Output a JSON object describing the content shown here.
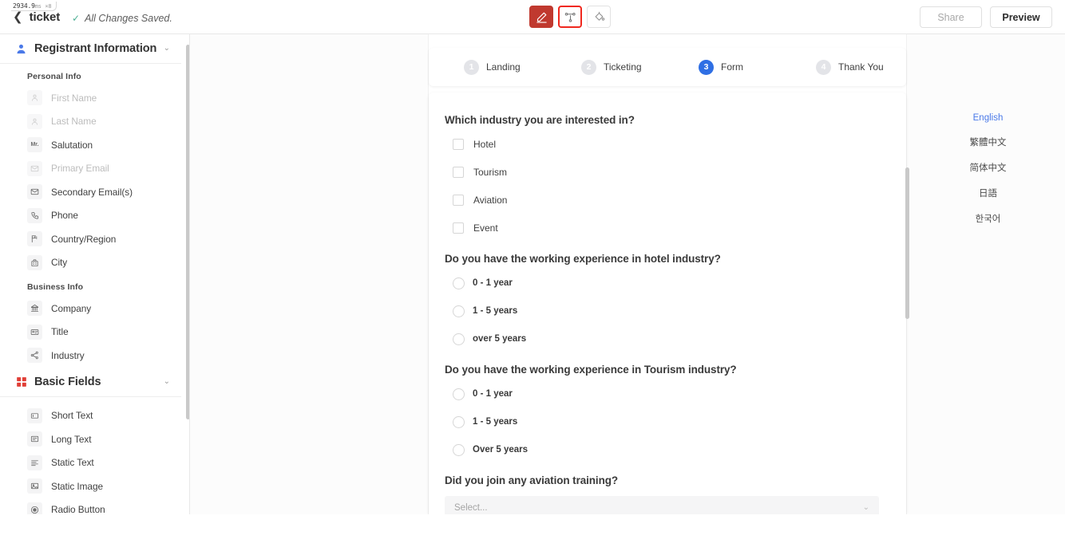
{
  "topbar": {
    "perf_value": "2934.9",
    "perf_unit": "ms",
    "perf_count": "×8",
    "back_icon": "chevron-left-icon",
    "project_name": "ticket",
    "check_icon": "check-icon",
    "save_status": "All Changes Saved.",
    "tools": [
      {
        "name": "edit-pencil-icon",
        "state": "filled"
      },
      {
        "name": "workflow-node-icon",
        "state": "selected"
      },
      {
        "name": "paint-bucket-icon",
        "state": "plain"
      }
    ],
    "share_label": "Share",
    "preview_label": "Preview"
  },
  "sidebar": {
    "panels": [
      {
        "title": "Registrant Information",
        "icon": "user-icon",
        "chevron": "chevron-down-icon",
        "groups": [
          {
            "label": "Personal Info",
            "items": [
              {
                "label": "First Name",
                "icon": "person-outline-icon",
                "disabled": true
              },
              {
                "label": "Last Name",
                "icon": "person-outline-icon",
                "disabled": true
              },
              {
                "label": "Salutation",
                "icon": "mr-icon",
                "disabled": false
              },
              {
                "label": "Primary Email",
                "icon": "envelope-icon",
                "disabled": true
              },
              {
                "label": "Secondary Email(s)",
                "icon": "envelope-icon",
                "disabled": false
              },
              {
                "label": "Phone",
                "icon": "phone-icon",
                "disabled": false
              },
              {
                "label": "Country/Region",
                "icon": "flag-icon",
                "disabled": false
              },
              {
                "label": "City",
                "icon": "building-icon",
                "disabled": false
              }
            ]
          },
          {
            "label": "Business Info",
            "items": [
              {
                "label": "Company",
                "icon": "bank-icon",
                "disabled": false
              },
              {
                "label": "Title",
                "icon": "id-card-icon",
                "disabled": false
              },
              {
                "label": "Industry",
                "icon": "share-nodes-icon",
                "disabled": false
              }
            ]
          }
        ]
      },
      {
        "title": "Basic Fields",
        "icon": "grid-squares-icon",
        "chevron": "chevron-down-icon",
        "groups": [
          {
            "label": "",
            "items": [
              {
                "label": "Short Text",
                "icon": "short-text-icon",
                "disabled": false
              },
              {
                "label": "Long Text",
                "icon": "long-text-icon",
                "disabled": false
              },
              {
                "label": "Static Text",
                "icon": "static-text-icon",
                "disabled": false
              },
              {
                "label": "Static Image",
                "icon": "image-icon",
                "disabled": false
              },
              {
                "label": "Radio Button",
                "icon": "radio-button-icon",
                "disabled": false
              }
            ]
          }
        ]
      }
    ]
  },
  "canvas": {
    "steps": [
      {
        "number": "1",
        "label": "Landing",
        "active": false
      },
      {
        "number": "2",
        "label": "Ticketing",
        "active": false
      },
      {
        "number": "3",
        "label": "Form",
        "active": true
      },
      {
        "number": "4",
        "label": "Thank You",
        "active": false
      }
    ],
    "questions": [
      {
        "title": "Which industry you are interested in?",
        "type": "checkbox",
        "options": [
          "Hotel",
          "Tourism",
          "Aviation",
          "Event"
        ]
      },
      {
        "title": "Do you have the working experience in hotel industry?",
        "type": "radio",
        "options": [
          "0 - 1 year",
          "1 - 5 years",
          "over 5 years"
        ]
      },
      {
        "title": "Do you have the working experience in Tourism industry?",
        "type": "radio",
        "options": [
          "0 - 1 year",
          "1 - 5 years",
          "Over 5 years"
        ]
      },
      {
        "title": "Did you join any aviation training?",
        "type": "select",
        "placeholder": "Select...",
        "value": ""
      }
    ],
    "languages": [
      {
        "label": "English",
        "active": true
      },
      {
        "label": "繁體中文",
        "active": false
      },
      {
        "label": "简体中文",
        "active": false
      },
      {
        "label": "日語",
        "active": false
      },
      {
        "label": "한국어",
        "active": false
      }
    ]
  },
  "colors": {
    "accent_red": "#c0392f",
    "highlight_red": "#f0281e",
    "active_step_blue": "#2f6fe4",
    "link_blue": "#4a79e8",
    "saved_green": "#4caf93"
  }
}
